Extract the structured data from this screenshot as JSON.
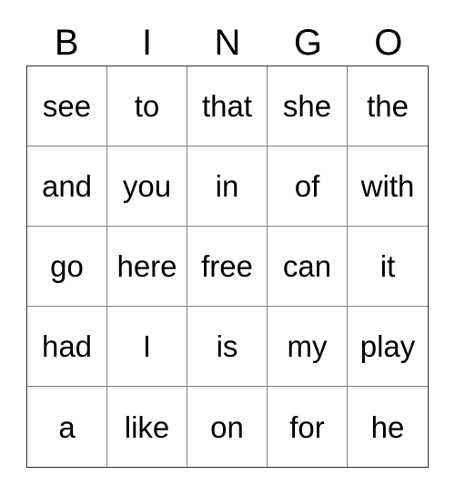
{
  "card": {
    "title": "BINGO",
    "header_letters": [
      "B",
      "I",
      "N",
      "G",
      "O"
    ],
    "grid_size": "5x5",
    "colors": {
      "page_background": "#ffffff",
      "cell_background": "#ffffff",
      "inner_line": "#7d7d7d",
      "outer_border": "#2b2b2b",
      "text": "#000000"
    },
    "rows": [
      {
        "cells": [
          "see",
          "to",
          "that",
          "she",
          "the"
        ]
      },
      {
        "cells": [
          "and",
          "you",
          "in",
          "of",
          "with"
        ]
      },
      {
        "cells": [
          "go",
          "here",
          "free",
          "can",
          "it"
        ]
      },
      {
        "cells": [
          "had",
          "I",
          "is",
          "my",
          "play"
        ]
      },
      {
        "cells": [
          "a",
          "like",
          "on",
          "for",
          "he"
        ]
      }
    ]
  }
}
